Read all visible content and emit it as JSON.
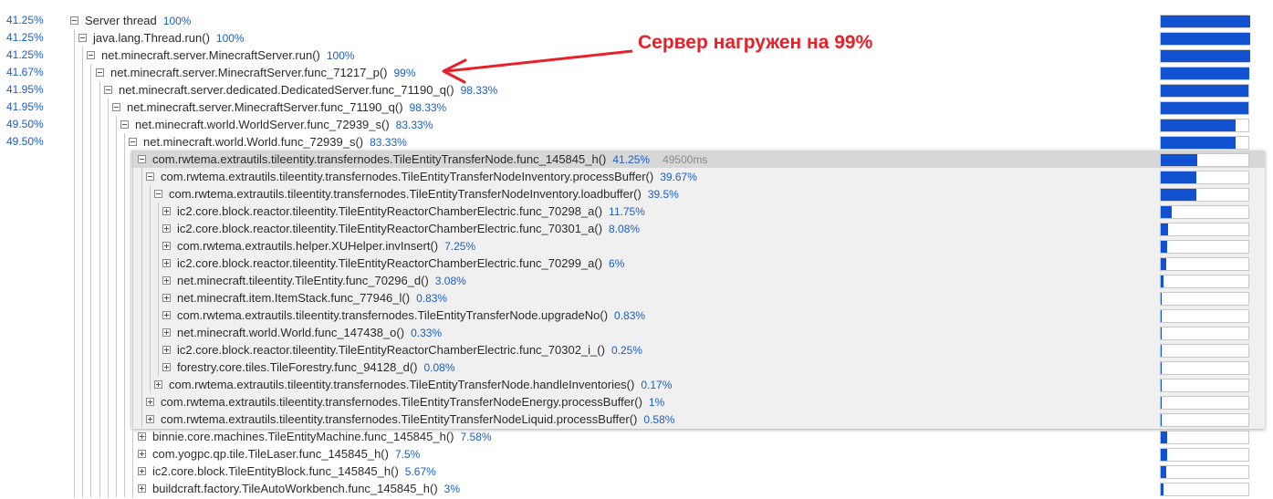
{
  "annotation": {
    "text": "Сервер нагружен на 99%",
    "color": "#e8202a"
  },
  "colors": {
    "percent": "#1a5fc8",
    "bar_fill": "#1252d1",
    "selected_row": "#d7d7d7",
    "selected_panel": "#f0f0f0"
  },
  "rows": [
    {
      "left_pct": "41.25%",
      "depth": 0,
      "toggle": "minus",
      "name": "Server thread",
      "pct": "100%",
      "bar": 1.0
    },
    {
      "left_pct": "41.25%",
      "depth": 1,
      "toggle": "minus",
      "name": "java.lang.Thread.run()",
      "pct": "100%",
      "bar": 1.0
    },
    {
      "left_pct": "41.25%",
      "depth": 2,
      "toggle": "minus",
      "name": "net.minecraft.server.MinecraftServer.run()",
      "pct": "100%",
      "bar": 1.0
    },
    {
      "left_pct": "41.67%",
      "depth": 3,
      "toggle": "minus",
      "name": "net.minecraft.server.MinecraftServer.func_71217_p()",
      "pct": "99%",
      "bar": 0.99
    },
    {
      "left_pct": "41.95%",
      "depth": 4,
      "toggle": "minus",
      "name": "net.minecraft.server.dedicated.DedicatedServer.func_71190_q()",
      "pct": "98.33%",
      "bar": 0.9833
    },
    {
      "left_pct": "41.95%",
      "depth": 5,
      "toggle": "minus",
      "name": "net.minecraft.server.MinecraftServer.func_71190_q()",
      "pct": "98.33%",
      "bar": 0.9833
    },
    {
      "left_pct": "49.50%",
      "depth": 6,
      "toggle": "minus",
      "name": "net.minecraft.world.WorldServer.func_72939_s()",
      "pct": "83.33%",
      "bar": 0.8333
    },
    {
      "left_pct": "49.50%",
      "depth": 7,
      "toggle": "minus",
      "name": "net.minecraft.world.World.func_72939_s()",
      "pct": "83.33%",
      "bar": 0.8333
    },
    {
      "left_pct": "",
      "depth": 8,
      "toggle": "minus",
      "name": "com.rwtema.extrautils.tileentity.transfernodes.TileEntityTransferNode.func_145845_h()",
      "pct": "41.25%",
      "time": "49500ms",
      "bar": 0.4125,
      "selected": true
    },
    {
      "left_pct": "",
      "depth": 9,
      "toggle": "minus",
      "name": "com.rwtema.extrautils.tileentity.transfernodes.TileEntityTransferNodeInventory.processBuffer()",
      "pct": "39.67%",
      "bar": 0.3967
    },
    {
      "left_pct": "",
      "depth": 10,
      "toggle": "minus",
      "name": "com.rwtema.extrautils.tileentity.transfernodes.TileEntityTransferNodeInventory.loadbuffer()",
      "pct": "39.5%",
      "bar": 0.395
    },
    {
      "left_pct": "",
      "depth": 11,
      "toggle": "plus",
      "name": "ic2.core.block.reactor.tileentity.TileEntityReactorChamberElectric.func_70298_a()",
      "pct": "11.75%",
      "bar": 0.1175
    },
    {
      "left_pct": "",
      "depth": 11,
      "toggle": "plus",
      "name": "ic2.core.block.reactor.tileentity.TileEntityReactorChamberElectric.func_70301_a()",
      "pct": "8.08%",
      "bar": 0.0808
    },
    {
      "left_pct": "",
      "depth": 11,
      "toggle": "plus",
      "name": "com.rwtema.extrautils.helper.XUHelper.invInsert()",
      "pct": "7.25%",
      "bar": 0.0725
    },
    {
      "left_pct": "",
      "depth": 11,
      "toggle": "plus",
      "name": "ic2.core.block.reactor.tileentity.TileEntityReactorChamberElectric.func_70299_a()",
      "pct": "6%",
      "bar": 0.06
    },
    {
      "left_pct": "",
      "depth": 11,
      "toggle": "plus",
      "name": "net.minecraft.tileentity.TileEntity.func_70296_d()",
      "pct": "3.08%",
      "bar": 0.0308
    },
    {
      "left_pct": "",
      "depth": 11,
      "toggle": "plus",
      "name": "net.minecraft.item.ItemStack.func_77946_l()",
      "pct": "0.83%",
      "bar": 0.0083
    },
    {
      "left_pct": "",
      "depth": 11,
      "toggle": "plus",
      "name": "com.rwtema.extrautils.tileentity.transfernodes.TileEntityTransferNode.upgradeNo()",
      "pct": "0.83%",
      "bar": 0.0083
    },
    {
      "left_pct": "",
      "depth": 11,
      "toggle": "plus",
      "name": "net.minecraft.world.World.func_147438_o()",
      "pct": "0.33%",
      "bar": 0.0033
    },
    {
      "left_pct": "",
      "depth": 11,
      "toggle": "plus",
      "name": "ic2.core.block.reactor.tileentity.TileEntityReactorChamberElectric.func_70302_i_()",
      "pct": "0.25%",
      "bar": 0.0025
    },
    {
      "left_pct": "",
      "depth": 11,
      "toggle": "plus",
      "name": "forestry.core.tiles.TileForestry.func_94128_d()",
      "pct": "0.08%",
      "bar": 0.0008
    },
    {
      "left_pct": "",
      "depth": 10,
      "toggle": "plus",
      "name": "com.rwtema.extrautils.tileentity.transfernodes.TileEntityTransferNode.handleInventories()",
      "pct": "0.17%",
      "bar": 0.0017
    },
    {
      "left_pct": "",
      "depth": 9,
      "toggle": "plus",
      "name": "com.rwtema.extrautils.tileentity.transfernodes.TileEntityTransferNodeEnergy.processBuffer()",
      "pct": "1%",
      "bar": 0.01
    },
    {
      "left_pct": "",
      "depth": 9,
      "toggle": "plus",
      "name": "com.rwtema.extrautils.tileentity.transfernodes.TileEntityTransferNodeLiquid.processBuffer()",
      "pct": "0.58%",
      "bar": 0.0058
    },
    {
      "left_pct": "",
      "depth": 8,
      "toggle": "plus",
      "name": "binnie.core.machines.TileEntityMachine.func_145845_h()",
      "pct": "7.58%",
      "bar": 0.0758
    },
    {
      "left_pct": "",
      "depth": 8,
      "toggle": "plus",
      "name": "com.yogpc.qp.tile.TileLaser.func_145845_h()",
      "pct": "7.5%",
      "bar": 0.075
    },
    {
      "left_pct": "",
      "depth": 8,
      "toggle": "plus",
      "name": "ic2.core.block.TileEntityBlock.func_145845_h()",
      "pct": "5.67%",
      "bar": 0.0567
    },
    {
      "left_pct": "",
      "depth": 8,
      "toggle": "plus",
      "name": "buildcraft.factory.TileAutoWorkbench.func_145845_h()",
      "pct": "3%",
      "bar": 0.03
    }
  ]
}
